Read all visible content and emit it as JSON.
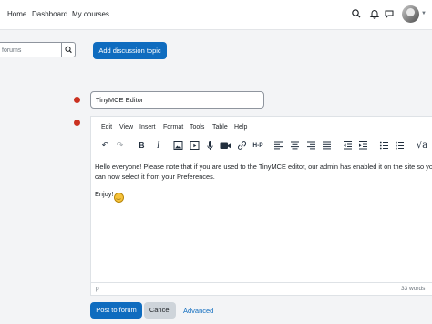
{
  "nav": {
    "home": "Home",
    "dashboard": "Dashboard",
    "my_courses": "My courses"
  },
  "forum": {
    "search_placeholder": "forums",
    "add_topic": "Add discussion topic"
  },
  "form": {
    "subject_value": "TinyMCE Editor",
    "menu": [
      "Edit",
      "View",
      "Insert",
      "Format",
      "Tools",
      "Table",
      "Help"
    ],
    "h5p_label": "H-P",
    "message_line1": "Hello everyone! Please note that if you are used to the TinyMCE editor, our admin has enabled it on the site so you",
    "message_line2": "can now select it from your Preferences.",
    "message_enjoy": "Enjoy!",
    "status_path": "p",
    "word_count": "33 words",
    "post_button": "Post to forum",
    "cancel_button": "Cancel",
    "advanced_link": "Advanced"
  },
  "colors": {
    "primary": "#0f6cbf",
    "required": "#ca3120",
    "secondary": "#ced4da"
  }
}
